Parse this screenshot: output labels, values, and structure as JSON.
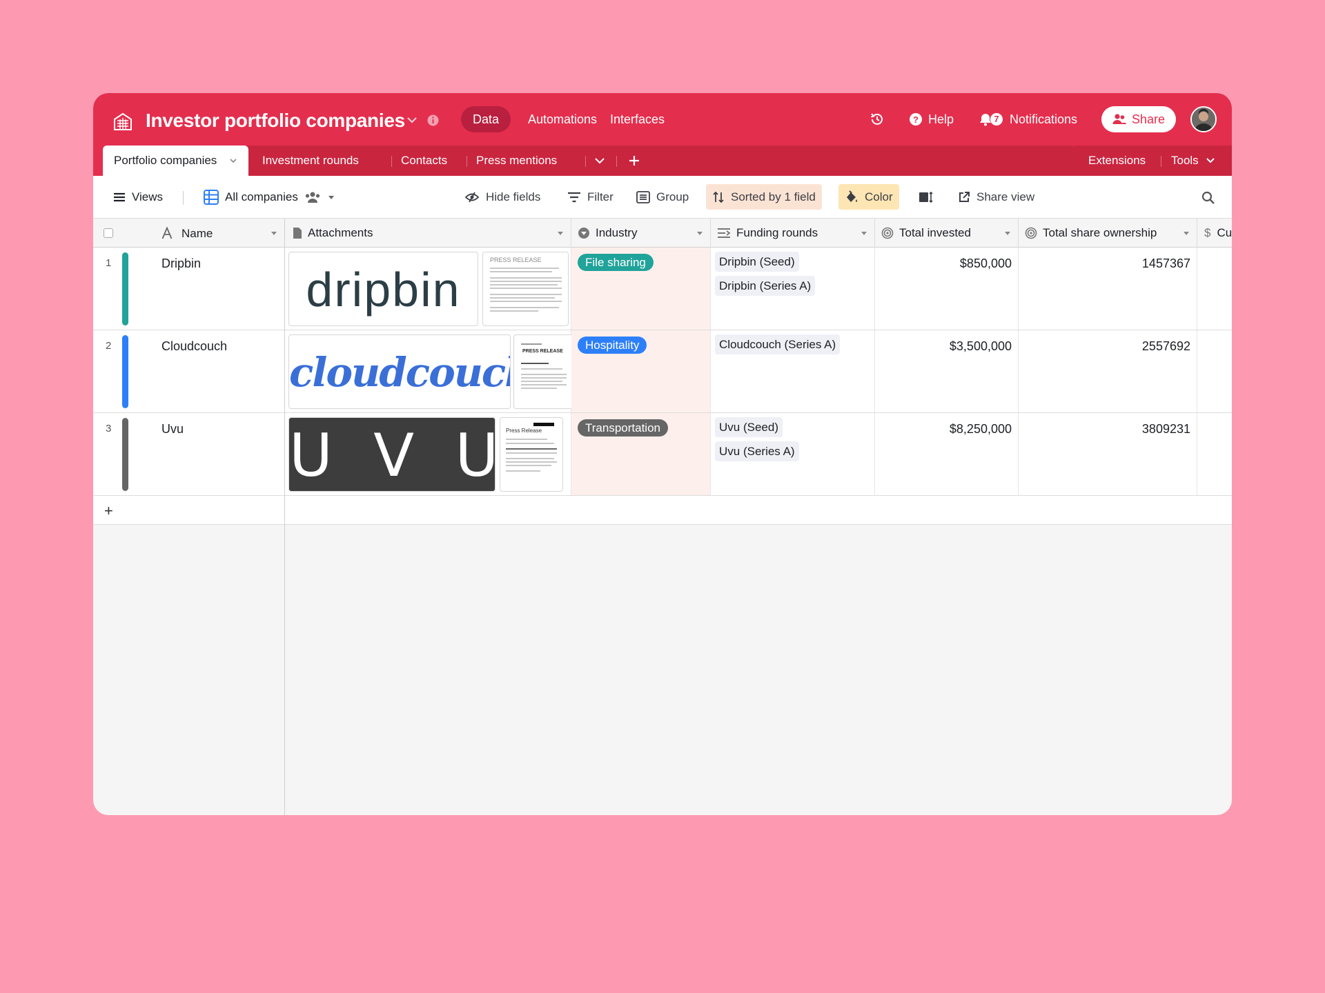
{
  "header": {
    "base_title": "Investor portfolio companies",
    "nav": [
      "Data",
      "Automations",
      "Interfaces"
    ],
    "help_label": "Help",
    "notifications_label": "Notifications",
    "notifications_count": "7",
    "share_label": "Share"
  },
  "tabs": {
    "tables": [
      "Portfolio companies",
      "Investment rounds",
      "Contacts",
      "Press mentions"
    ],
    "extensions_label": "Extensions",
    "tools_label": "Tools"
  },
  "toolbar": {
    "views_label": "Views",
    "view_name": "All companies",
    "hide_fields": "Hide fields",
    "filter": "Filter",
    "group": "Group",
    "sorted": "Sorted by 1 field",
    "color": "Color",
    "share_view": "Share view"
  },
  "columns": [
    "Name",
    "Attachments",
    "Industry",
    "Funding rounds",
    "Total invested",
    "Total share ownership",
    "Cu"
  ],
  "rows": [
    {
      "num": "1",
      "name": "Dripbin",
      "color": "#20a39a",
      "logo_text": "dripbin",
      "press_label": "PRESS RELEASE",
      "industry": "File sharing",
      "industry_color": "#20a39a",
      "funding": [
        "Dripbin (Seed)",
        "Dripbin (Series A)"
      ],
      "total_invested": "$850,000",
      "share_ownership": "1457367"
    },
    {
      "num": "2",
      "name": "Cloudcouch",
      "color": "#2d7ff9",
      "logo_text": "cloudcouch",
      "press_label": "PRESS RELEASE",
      "industry": "Hospitality",
      "industry_color": "#2d7ff9",
      "funding": [
        "Cloudcouch (Series A)"
      ],
      "total_invested": "$3,500,000",
      "share_ownership": "2557692"
    },
    {
      "num": "3",
      "name": "Uvu",
      "color": "#666666",
      "logo_text": "U V U",
      "press_label": "Press Release",
      "industry": "Transportation",
      "industry_color": "#666666",
      "funding": [
        "Uvu (Seed)",
        "Uvu (Series A)"
      ],
      "total_invested": "$8,250,000",
      "share_ownership": "3809231"
    }
  ],
  "colors": {
    "brand": "#e42e4e",
    "brand_dark": "#c9253f",
    "background": "#fd9ab1"
  }
}
